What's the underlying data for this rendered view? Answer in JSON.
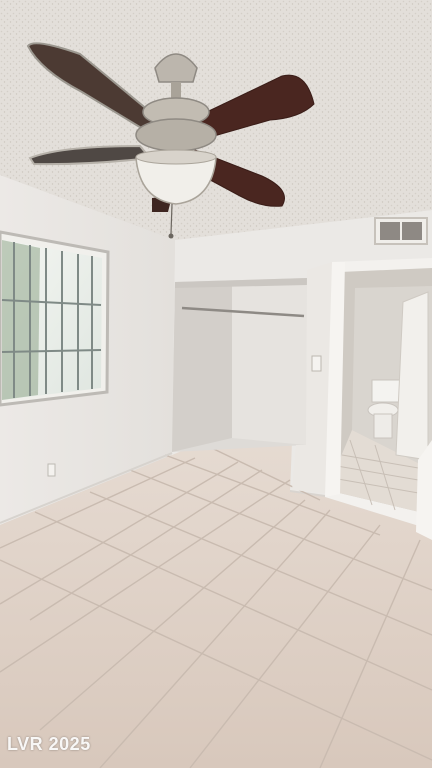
{
  "photo": {
    "subject": "empty-bedroom-interior",
    "watermark": "LVR 2025",
    "colors": {
      "ceiling": "#e3dfda",
      "wall": "#e9e6e2",
      "floor_tile": "#ddd0c6",
      "grout": "#c8b9ad",
      "fan_blade": "#4b2a22",
      "fan_metal": "#bdb7ad"
    }
  }
}
